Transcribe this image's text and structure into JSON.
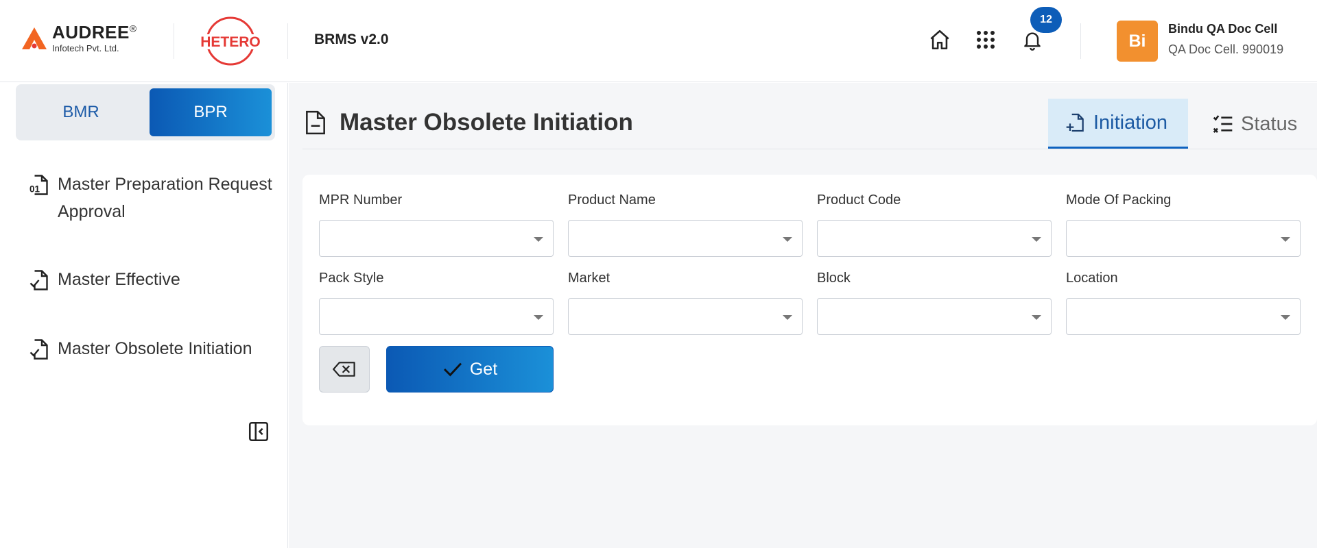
{
  "header": {
    "logo_name": "AUDREE",
    "logo_reg": "®",
    "logo_sub": "Infotech Pvt. Ltd.",
    "partner_logo": "HETERO",
    "app_name": "BRMS v2.0",
    "home_icon": "home-icon",
    "apps_icon": "apps-grid-icon",
    "bell_icon": "bell-icon",
    "notification_count": "12",
    "user": {
      "avatar_initials": "Bi",
      "name": "Bindu QA Doc Cell",
      "role": "QA Doc Cell. 990019"
    },
    "colors": {
      "accent": "#0d5db8",
      "avatar": "#f2902f",
      "logo_red": "#e53935",
      "logo_orange": "#f26522"
    }
  },
  "sidebar": {
    "toggle": {
      "bmr": "BMR",
      "bpr": "BPR",
      "active": "BPR"
    },
    "items": [
      {
        "label": "Master Preparation Request Approval",
        "icon": "file-number-icon"
      },
      {
        "label": "Master Effective",
        "icon": "file-check-icon"
      },
      {
        "label": "Master Obsolete Initiation",
        "icon": "file-check-icon"
      }
    ],
    "collapse_icon": "collapse-sidebar-icon"
  },
  "main": {
    "title": "Master Obsolete Initiation",
    "title_icon": "file-minus-icon",
    "tabs": [
      {
        "label": "Initiation",
        "icon": "file-plus-icon",
        "active": true
      },
      {
        "label": "Status",
        "icon": "checklist-icon",
        "active": false
      }
    ],
    "form": {
      "fields": [
        {
          "label": "MPR Number",
          "value": ""
        },
        {
          "label": "Product Name",
          "value": ""
        },
        {
          "label": "Product Code",
          "value": ""
        },
        {
          "label": "Mode Of Packing",
          "value": ""
        },
        {
          "label": "Pack Style",
          "value": ""
        },
        {
          "label": "Market",
          "value": ""
        },
        {
          "label": "Block",
          "value": ""
        },
        {
          "label": "Location",
          "value": ""
        }
      ],
      "clear_icon": "backspace-clear-icon",
      "get_label": "Get",
      "get_icon": "check-icon"
    }
  }
}
